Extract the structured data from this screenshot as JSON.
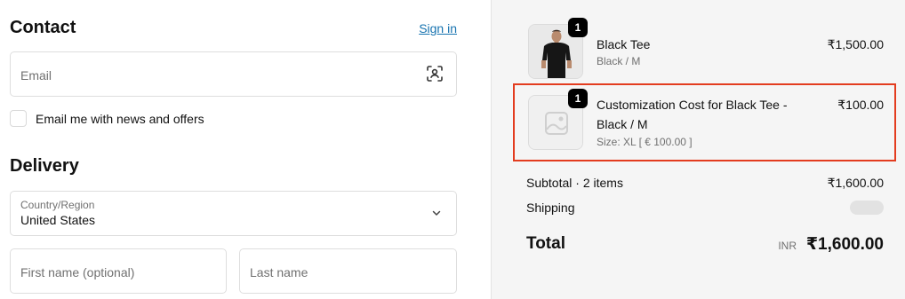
{
  "contact": {
    "heading": "Contact",
    "sign_in": "Sign in",
    "email_placeholder": "Email",
    "newsletter_label": "Email me with news and offers"
  },
  "delivery": {
    "heading": "Delivery",
    "country_label": "Country/Region",
    "country_value": "United States",
    "first_name_placeholder": "First name (optional)",
    "last_name_placeholder": "Last name"
  },
  "cart": {
    "items": [
      {
        "title": "Black Tee",
        "variant": "Black / M",
        "price": "₹1,500.00",
        "quantity": "1",
        "image": "tshirt-photo"
      },
      {
        "title_line1": "Customization Cost for Black Tee -",
        "title_line2": "Black / M",
        "variant": "Size: XL [ € 100.00 ]",
        "price": "₹100.00",
        "quantity": "1",
        "image": "placeholder-image-icon"
      }
    ],
    "subtotal_label": "Subtotal · 2 items",
    "subtotal_value": "₹1,600.00",
    "shipping_label": "Shipping",
    "total_label": "Total",
    "currency": "INR",
    "total_value": "₹1,600.00",
    "highlight_color": "#e33c1f"
  }
}
